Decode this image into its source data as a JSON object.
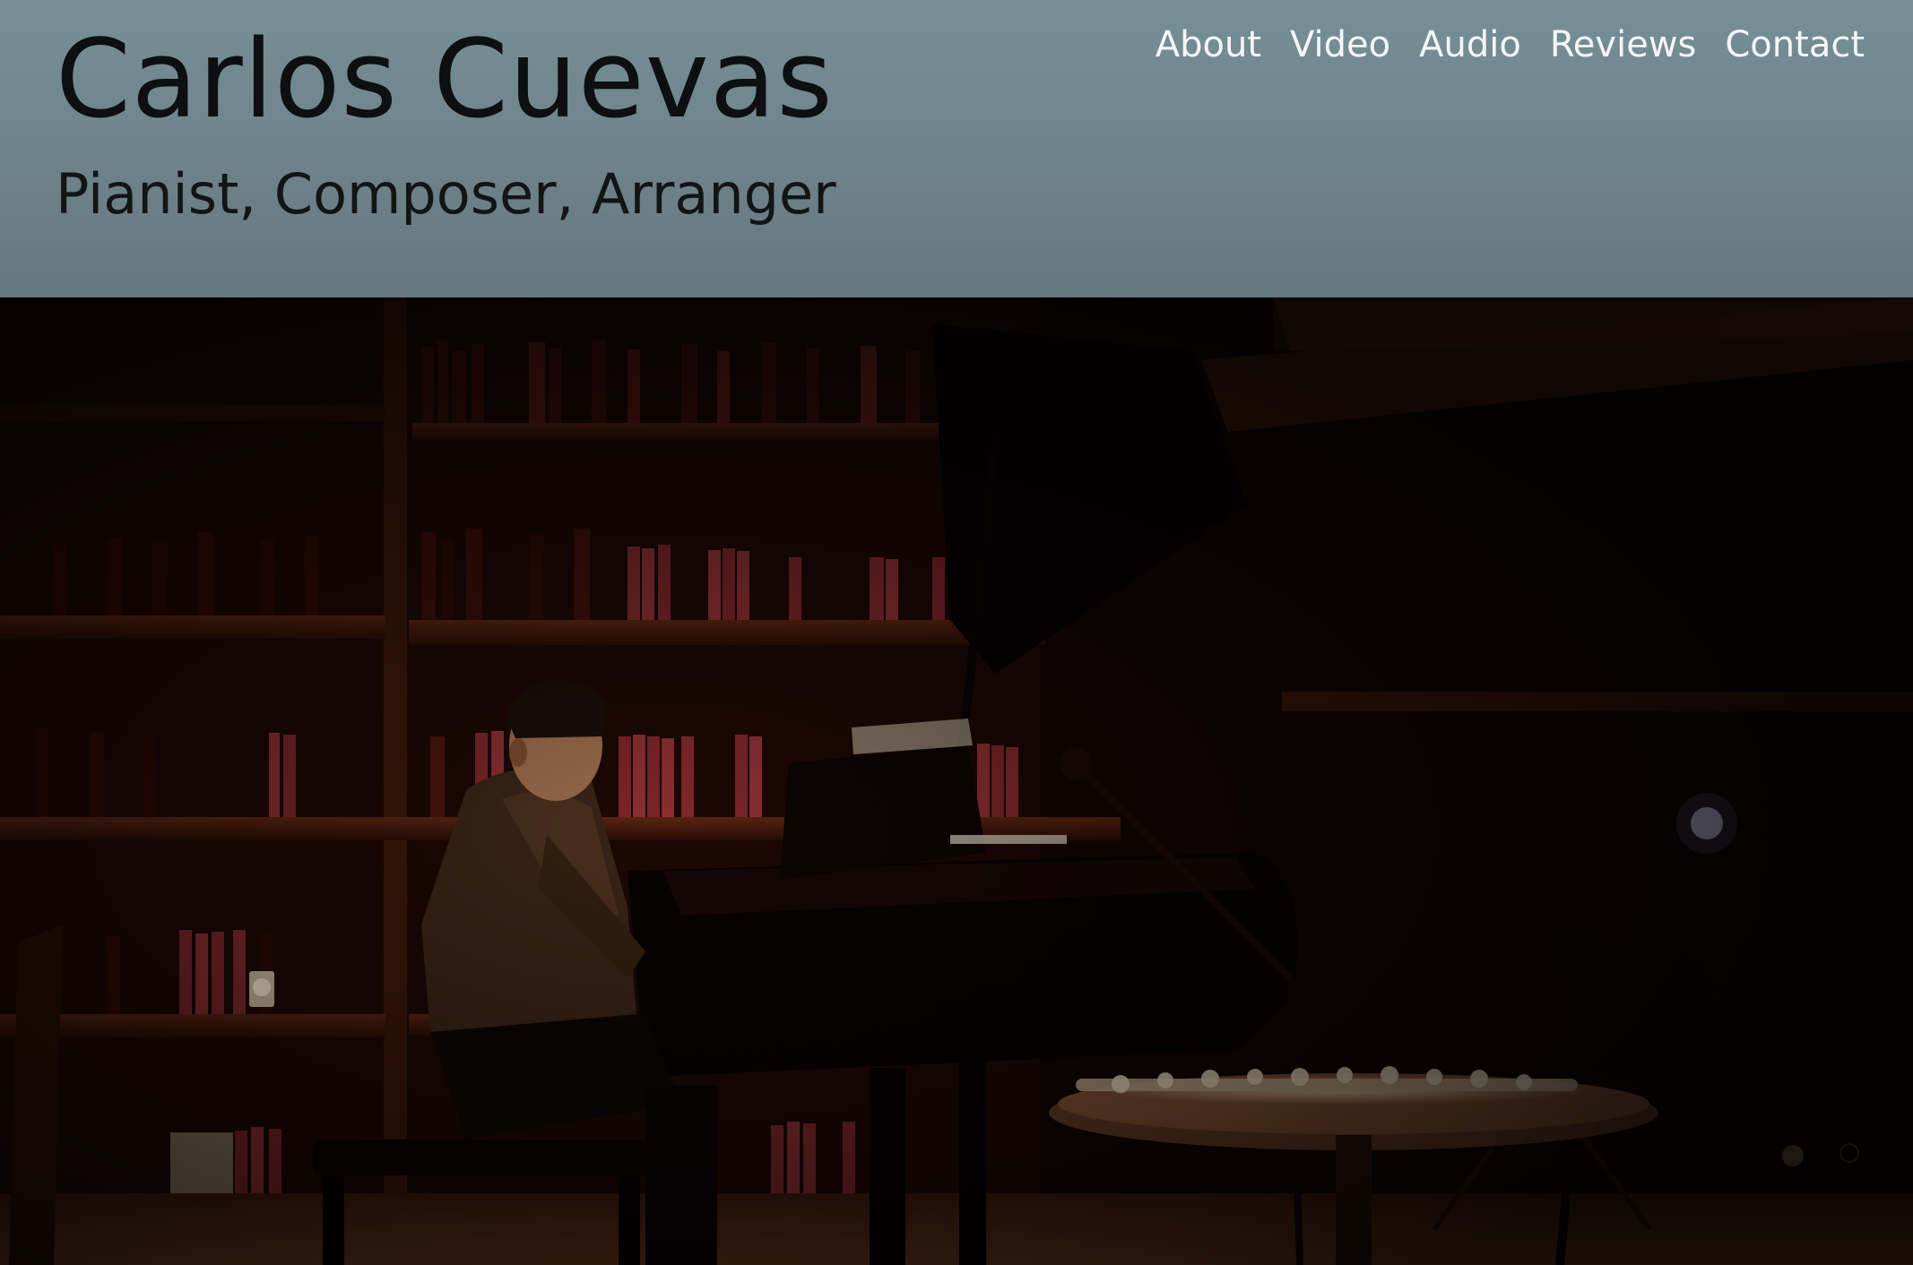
{
  "header": {
    "title": "Carlos Cuevas",
    "subtitle": "Pianist, Composer, Arranger"
  },
  "nav": {
    "items": [
      {
        "label": "About"
      },
      {
        "label": "Video"
      },
      {
        "label": "Audio"
      },
      {
        "label": "Reviews"
      },
      {
        "label": "Contact"
      }
    ]
  },
  "hero": {
    "image_subject": "pianist-performing-at-grand-piano-in-library"
  },
  "colors": {
    "header_bg": "#708890",
    "title_text": "#0d0f10",
    "nav_text": "#f4f6f7",
    "hero_warm": "#3a1409"
  }
}
